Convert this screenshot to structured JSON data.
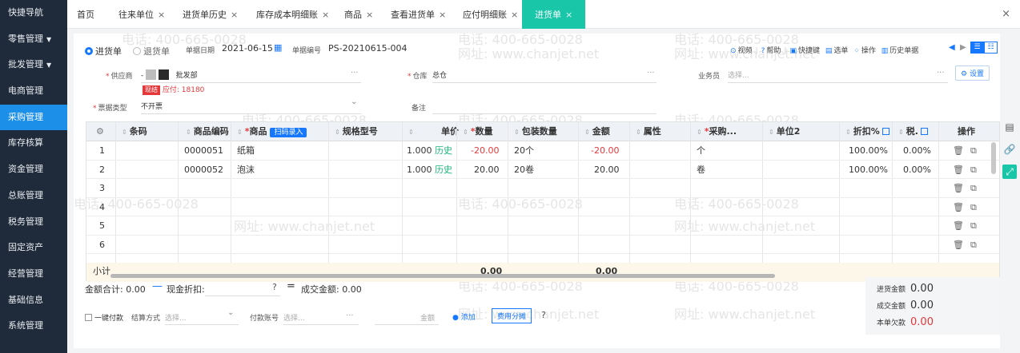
{
  "sidebar": {
    "items": [
      {
        "label": "快捷导航",
        "caret": ""
      },
      {
        "label": "零售管理",
        "caret": "▼"
      },
      {
        "label": "批发管理",
        "caret": "▼"
      },
      {
        "label": "电商管理",
        "caret": ""
      },
      {
        "label": "采购管理",
        "caret": ""
      },
      {
        "label": "库存核算",
        "caret": ""
      },
      {
        "label": "资金管理",
        "caret": ""
      },
      {
        "label": "总账管理",
        "caret": ""
      },
      {
        "label": "税务管理",
        "caret": ""
      },
      {
        "label": "固定资产",
        "caret": ""
      },
      {
        "label": "经营管理",
        "caret": ""
      },
      {
        "label": "基础信息",
        "caret": ""
      },
      {
        "label": "系统管理",
        "caret": ""
      }
    ]
  },
  "tabs": {
    "home": "首页",
    "items": [
      "往来单位",
      "进货单历史",
      "库存成本明细账",
      "商品",
      "查看进货单",
      "应付明细账",
      "进货单"
    ],
    "close": "×",
    "close_all": "×"
  },
  "header": {
    "radio_purchase": "进货单",
    "radio_return": "退货单",
    "date_label": "单据日期",
    "date_value": "2021-06-15",
    "no_label": "单据编号",
    "no_value": "PS-20210615-004",
    "toolbar": {
      "video": "视频",
      "help": "帮助",
      "shortcut": "快捷键",
      "select": "选单",
      "operate": "操作",
      "history": "历史单据"
    }
  },
  "form": {
    "supplier_label": "供应商",
    "supplier_value": "批发部",
    "supplier_prefix": "-",
    "cash_badge": "现结",
    "payable": "应付: 18180",
    "warehouse_label": "仓库",
    "warehouse_value": "总仓",
    "salesman_label": "业务员",
    "salesman_placeholder": "选择...",
    "settings_btn": "设置",
    "bill_type_label": "票据类型",
    "bill_type_value": "不开票",
    "remark_label": "备注",
    "more": "···"
  },
  "table": {
    "headers": {
      "barcode": "条码",
      "code": "商品编码",
      "name": "商品",
      "scan": "扫码录入",
      "spec": "规格型号",
      "price": "单价",
      "qty": "数量",
      "pack": "包装数量",
      "amount": "金额",
      "attr": "属性",
      "purchase_unit": "采购...",
      "unit2": "单位2",
      "discount": "折扣%",
      "tax": "税.",
      "ops": "操作"
    },
    "rows": [
      {
        "no": "1",
        "code": "0000051",
        "name": "纸箱",
        "price": "1.000",
        "history": "历史",
        "qty": "-20.00",
        "pack": "20个",
        "amount": "-20.00",
        "unit": "个",
        "discount": "100.00%",
        "tax": "0.00%"
      },
      {
        "no": "2",
        "code": "0000052",
        "name": "泡沫",
        "price": "1.000",
        "history": "历史",
        "qty": "20.00",
        "pack": "20卷",
        "amount": "20.00",
        "unit": "卷",
        "discount": "100.00%",
        "tax": "0.00%"
      },
      {
        "no": "3"
      },
      {
        "no": "4"
      },
      {
        "no": "5"
      },
      {
        "no": "6"
      }
    ],
    "subtotal_label": "小计",
    "subtotal_qty": "0.00",
    "subtotal_amount": "0.00"
  },
  "footer": {
    "total_label": "金额合计: 0.00",
    "cash_discount_label": "现金折扣:",
    "deal_label": "成交金额: 0.00",
    "one_click_pay": "一键付款",
    "settle_label": "结算方式",
    "settle_placeholder": "选择...",
    "account_label": "付款账号",
    "account_placeholder": "选择...",
    "amount_label": "金额",
    "add_btn": "添加",
    "split_btn": "费用分摊"
  },
  "summary": {
    "purchase_amount_label": "进货金额",
    "purchase_amount": "0.00",
    "deal_amount_label": "成交金额",
    "deal_amount": "0.00",
    "owed_label": "本单欠款",
    "owed": "0.00"
  },
  "watermark": {
    "phone": "电话: 400-665-0028",
    "site": "网址: www.chanjet.net"
  },
  "colors": {
    "sidebar_bg": "#1f2b3a",
    "sidebar_active": "#1c8fe8",
    "tab_active": "#19c6a8",
    "accent": "#1677ff",
    "danger": "#e5383b"
  }
}
